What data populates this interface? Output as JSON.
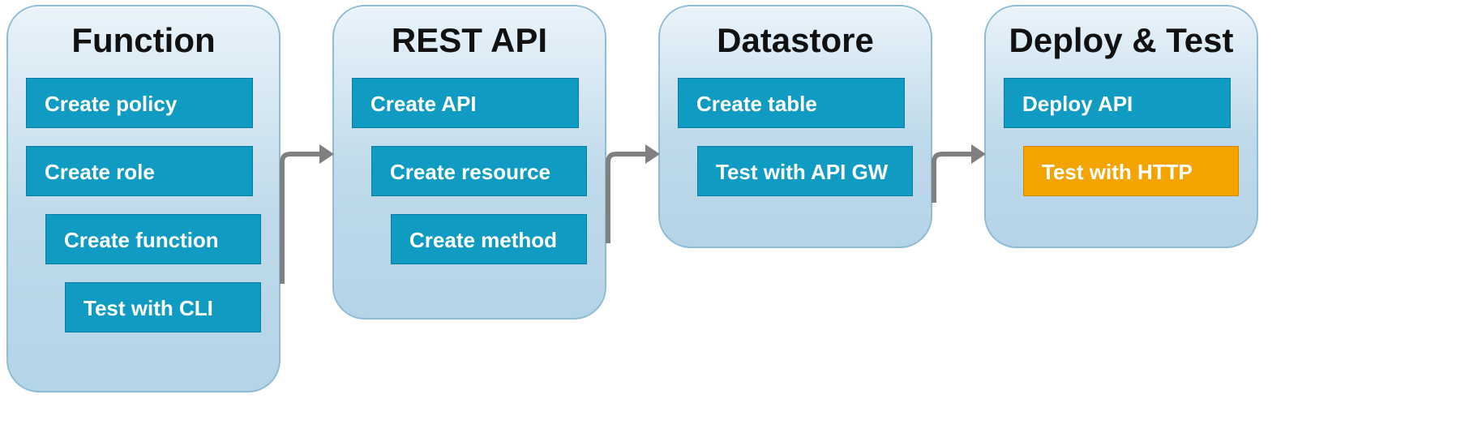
{
  "colors": {
    "step_bg": "#0f9bc2",
    "highlight_bg": "#f4a400",
    "card_border": "#8ebcd6",
    "arrow": "#808080"
  },
  "stages": [
    {
      "title": "Function",
      "steps": [
        {
          "label": "Create policy",
          "indent": 0,
          "highlight": false
        },
        {
          "label": "Create role",
          "indent": 0,
          "highlight": false
        },
        {
          "label": "Create function",
          "indent": 1,
          "highlight": false
        },
        {
          "label": "Test with CLI",
          "indent": 2,
          "highlight": false
        }
      ]
    },
    {
      "title": "REST API",
      "steps": [
        {
          "label": "Create API",
          "indent": 0,
          "highlight": false
        },
        {
          "label": "Create resource",
          "indent": 1,
          "highlight": false
        },
        {
          "label": "Create method",
          "indent": 2,
          "highlight": false
        }
      ]
    },
    {
      "title": "Datastore",
      "steps": [
        {
          "label": "Create table",
          "indent": 0,
          "highlight": false
        },
        {
          "label": "Test with API GW",
          "indent": 1,
          "highlight": false
        }
      ]
    },
    {
      "title": "Deploy & Test",
      "steps": [
        {
          "label": "Deploy API",
          "indent": 0,
          "highlight": false
        },
        {
          "label": "Test with HTTP",
          "indent": 1,
          "highlight": true
        }
      ]
    }
  ]
}
